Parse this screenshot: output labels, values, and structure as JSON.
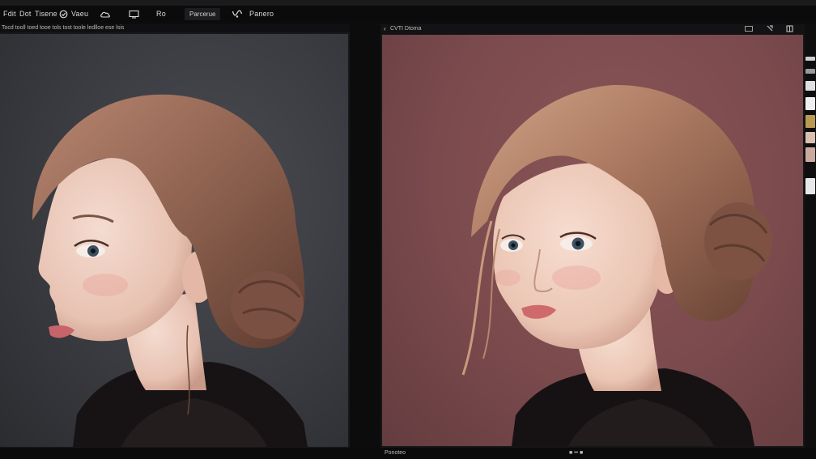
{
  "menubar": {
    "items": [
      "Fdit",
      "Dot",
      "Tisene",
      "Vaeu",
      "Ro"
    ],
    "button_label": "Parcerue",
    "end_label": "Panero"
  },
  "left_panel": {
    "toolbar_text": "Tocd tooll toed tooe tols tost toole ledlloe ese lsis",
    "icons": [
      "undo-icon",
      "crop-icon",
      "image-icon"
    ]
  },
  "right_panel": {
    "tab_label": "CVTI Dtoma",
    "header_icons": [
      "window-icon",
      "pin-icon",
      "grid-icon"
    ]
  },
  "statusbar": {
    "left_text": "Ponoteo",
    "right_text": "■ •• ■"
  },
  "colors": {
    "left_background": "#3a3b40",
    "right_background": "#7a4a4d",
    "hair": "#8a5e4a",
    "skin": "#efcfc0",
    "lace": "#1a1616"
  }
}
